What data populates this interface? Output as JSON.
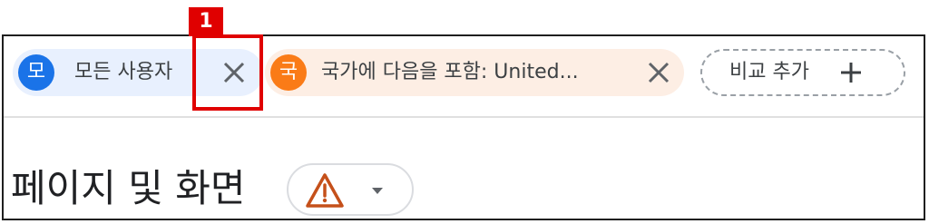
{
  "filters": {
    "all_users": {
      "avatar_letter": "모",
      "label": "모든 사용자",
      "close_icon": "close-icon",
      "color": "#1a73e8",
      "background": "#e8f0fe"
    },
    "country": {
      "avatar_letter": "국",
      "label": "국가에 다음을 포함: United...",
      "close_icon": "close-icon",
      "color": "#fa7b17",
      "background": "#fdeee4"
    },
    "add_comparison": {
      "label": "비교 추가",
      "icon": "plus-icon"
    }
  },
  "section": {
    "title": "페이지 및 화면",
    "warning_icon": "warning-icon",
    "warning_color": "#c5501a",
    "dropdown_icon": "caret-down-icon"
  },
  "annotation": {
    "label": "1",
    "color": "#e00000"
  }
}
